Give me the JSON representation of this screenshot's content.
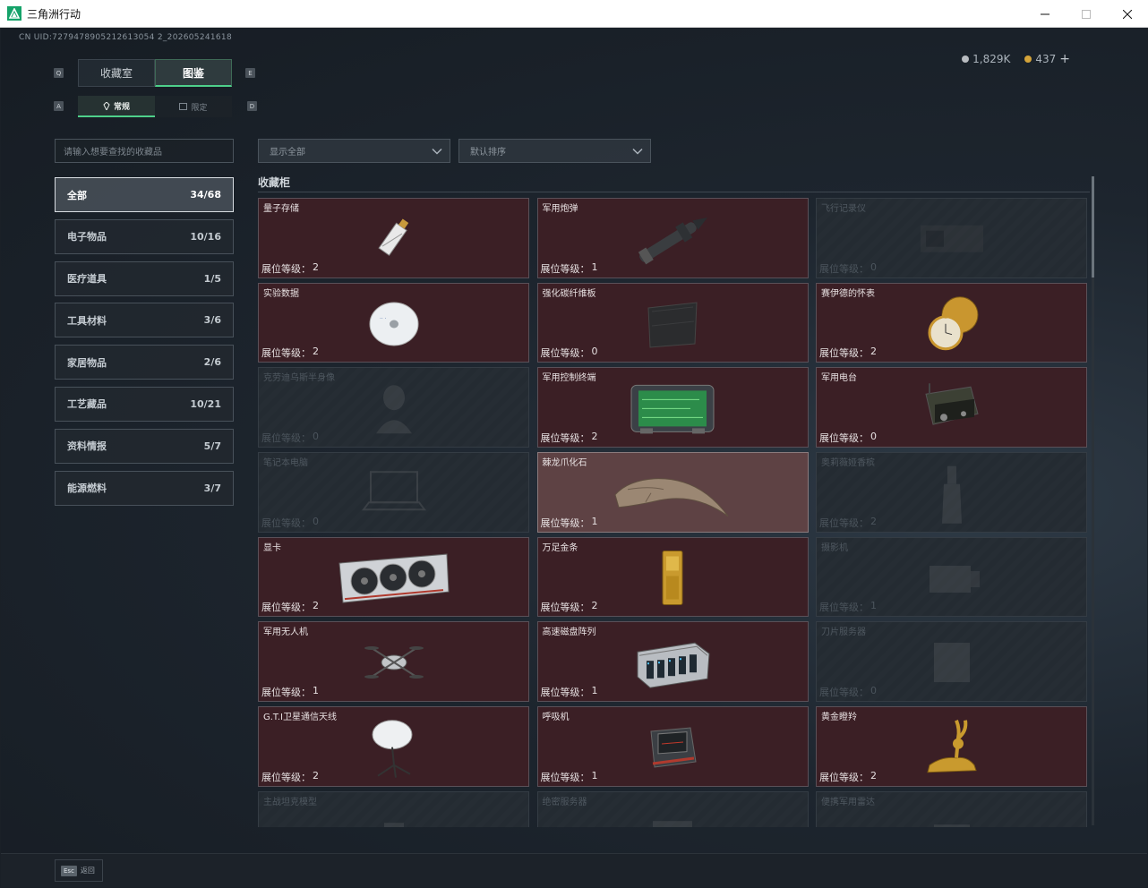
{
  "window": {
    "title": "三角洲行动"
  },
  "uid": "CN UID:7279478905212613054 2_202605241618",
  "currency": {
    "silver": "1,829K",
    "gold": "437",
    "plus": "+"
  },
  "tabs": {
    "main": [
      {
        "label": "收藏室"
      },
      {
        "label": "图鉴"
      }
    ],
    "sub": [
      {
        "label": "常规"
      },
      {
        "label": "限定"
      }
    ],
    "keys": {
      "q": "Q",
      "e": "E",
      "a": "A",
      "d": "D"
    }
  },
  "search": {
    "placeholder": "请输入想要查找的收藏品"
  },
  "filters": {
    "display": "显示全部",
    "sort": "默认排序"
  },
  "categories": [
    {
      "name": "全部",
      "count": "34/68"
    },
    {
      "name": "电子物品",
      "count": "10/16"
    },
    {
      "name": "医疗道具",
      "count": "1/5"
    },
    {
      "name": "工具材料",
      "count": "3/6"
    },
    {
      "name": "家居物品",
      "count": "2/6"
    },
    {
      "name": "工艺藏品",
      "count": "10/21"
    },
    {
      "name": "资料情报",
      "count": "5/7"
    },
    {
      "name": "能源燃料",
      "count": "3/7"
    }
  ],
  "section_title": "收藏柜",
  "level_label": "展位等级：",
  "items": [
    {
      "name": "量子存储",
      "level": "2",
      "state": "owned",
      "icon": "usb-drive-icon"
    },
    {
      "name": "军用炮弹",
      "level": "1",
      "state": "owned",
      "icon": "artillery-shell-icon"
    },
    {
      "name": "飞行记录仪",
      "level": "0",
      "state": "locked",
      "icon": "flight-recorder-icon"
    },
    {
      "name": "实验数据",
      "level": "2",
      "state": "owned",
      "icon": "disc-icon"
    },
    {
      "name": "强化碳纤维板",
      "level": "0",
      "state": "owned",
      "icon": "carbon-plate-icon"
    },
    {
      "name": "赛伊德的怀表",
      "level": "2",
      "state": "owned",
      "icon": "pocket-watch-icon"
    },
    {
      "name": "克劳迪乌斯半身像",
      "level": "0",
      "state": "locked",
      "icon": "bust-icon"
    },
    {
      "name": "军用控制终端",
      "level": "2",
      "state": "owned",
      "icon": "control-terminal-icon"
    },
    {
      "name": "军用电台",
      "level": "0",
      "state": "owned",
      "icon": "radio-icon"
    },
    {
      "name": "笔记本电脑",
      "level": "0",
      "state": "locked",
      "icon": "laptop-icon"
    },
    {
      "name": "棘龙爪化石",
      "level": "1",
      "state": "highlight",
      "icon": "claw-fossil-icon"
    },
    {
      "name": "奥莉薇娅香槟",
      "level": "2",
      "state": "locked",
      "icon": "champagne-icon"
    },
    {
      "name": "显卡",
      "level": "2",
      "state": "owned",
      "icon": "gpu-icon"
    },
    {
      "name": "万足金条",
      "level": "2",
      "state": "owned",
      "icon": "gold-bar-icon"
    },
    {
      "name": "摄影机",
      "level": "1",
      "state": "locked",
      "icon": "camera-icon"
    },
    {
      "name": "军用无人机",
      "level": "1",
      "state": "owned",
      "icon": "drone-icon"
    },
    {
      "name": "高速磁盘阵列",
      "level": "1",
      "state": "owned",
      "icon": "disk-array-icon"
    },
    {
      "name": "刀片服务器",
      "level": "0",
      "state": "locked",
      "icon": "blade-server-icon"
    },
    {
      "name": "G.T.I卫星通信天线",
      "level": "2",
      "state": "owned",
      "icon": "satellite-dish-icon"
    },
    {
      "name": "呼吸机",
      "level": "1",
      "state": "owned",
      "icon": "ventilator-icon"
    },
    {
      "name": "黄金瞪羚",
      "level": "2",
      "state": "owned",
      "icon": "gold-gazelle-icon"
    },
    {
      "name": "主战坦克模型",
      "level": "",
      "state": "locked",
      "icon": "tank-model-icon"
    },
    {
      "name": "绝密服务器",
      "level": "",
      "state": "locked",
      "icon": "server-icon"
    },
    {
      "name": "便携军用雷达",
      "level": "",
      "state": "locked",
      "icon": "radar-icon"
    }
  ],
  "footer": {
    "esc_key": "Esc",
    "esc_label": "返回"
  },
  "colors": {
    "accent": "#4ed08a",
    "owned_card": "#3b1f25",
    "highlight_card": "#5e4244",
    "locked_card": "#242b32"
  }
}
